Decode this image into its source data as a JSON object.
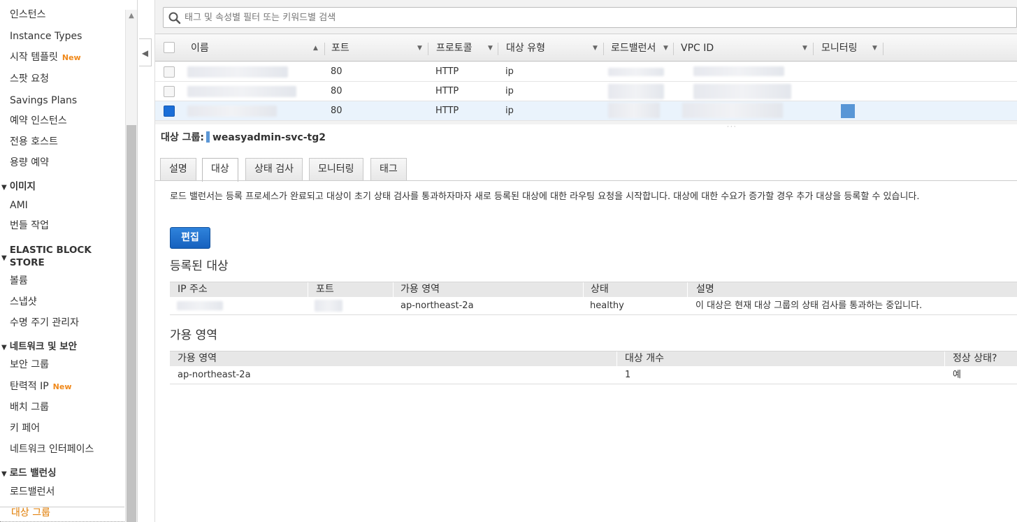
{
  "sidebar": {
    "items": [
      {
        "label": "인스턴스"
      },
      {
        "label": "Instance Types"
      },
      {
        "label": "시작 템플릿",
        "badge": "New"
      },
      {
        "label": "스팟 요청"
      },
      {
        "label": "Savings Plans"
      },
      {
        "label": "예약 인스턴스"
      },
      {
        "label": "전용 호스트"
      },
      {
        "label": "용량 예약"
      }
    ],
    "images_section": {
      "title": "이미지",
      "items": [
        "AMI",
        "번들 작업"
      ]
    },
    "ebs_section": {
      "title_line1": "ELASTIC BLOCK",
      "title_line2": "STORE",
      "items": [
        "볼륨",
        "스냅샷",
        "수명 주기 관리자"
      ]
    },
    "network_section": {
      "title": "네트워크 및 보안",
      "items": [
        "보안 그룹",
        "탄력적 IP",
        "배치 그룹",
        "키 페어",
        "네트워크 인터페이스"
      ],
      "elastic_ip_badge": "New"
    },
    "lb_section": {
      "title": "로드 밸런싱",
      "items": [
        "로드밸런서",
        "대상 그룹"
      ],
      "active_item": "대상 그룹"
    }
  },
  "search": {
    "placeholder": "태그 및 속성별 필터 또는 키워드별 검색"
  },
  "grid": {
    "columns": [
      "이름",
      "포트",
      "프로토콜",
      "대상 유형",
      "로드밸런서",
      "VPC ID",
      "모니터링"
    ],
    "rows": [
      {
        "port": "80",
        "protocol": "HTTP",
        "target_type": "ip",
        "selected": false
      },
      {
        "port": "80",
        "protocol": "HTTP",
        "target_type": "ip",
        "selected": false
      },
      {
        "port": "80",
        "protocol": "HTTP",
        "target_type": "ip",
        "selected": true
      }
    ]
  },
  "detail": {
    "label": "대상 그룹:",
    "name": "weasyadmin-svc-tg2",
    "tabs": [
      "설명",
      "대상",
      "상태 검사",
      "모니터링",
      "태그"
    ],
    "active_tab": "대상",
    "description": "로드 밸런서는 등록 프로세스가 완료되고 대상이 초기 상태 검사를 통과하자마자 새로 등록된 대상에 대한 라우팅 요청을 시작합니다. 대상에 대한 수요가 증가할 경우 추가 대상을 등록할 수 있습니다.",
    "edit_label": "편집"
  },
  "registered_targets": {
    "title": "등록된 대상",
    "columns": [
      "IP 주소",
      "포트",
      "가용 영역",
      "상태",
      "설명"
    ],
    "rows": [
      {
        "az": "ap-northeast-2a",
        "status": "healthy",
        "description": "이 대상은 현재 대상 그룹의 상태 검사를 통과하는 중입니다."
      }
    ]
  },
  "availability_zones": {
    "title": "가용 영역",
    "columns": [
      "가용 영역",
      "대상 개수",
      "정상 상태?"
    ],
    "rows": [
      {
        "az": "ap-northeast-2a",
        "count": "1",
        "healthy": "예"
      }
    ]
  },
  "colors": {
    "accent": "#1a6ed8",
    "active_nav": "#e07b00",
    "new_badge": "#f0891b",
    "monitor": "#5896d6"
  }
}
